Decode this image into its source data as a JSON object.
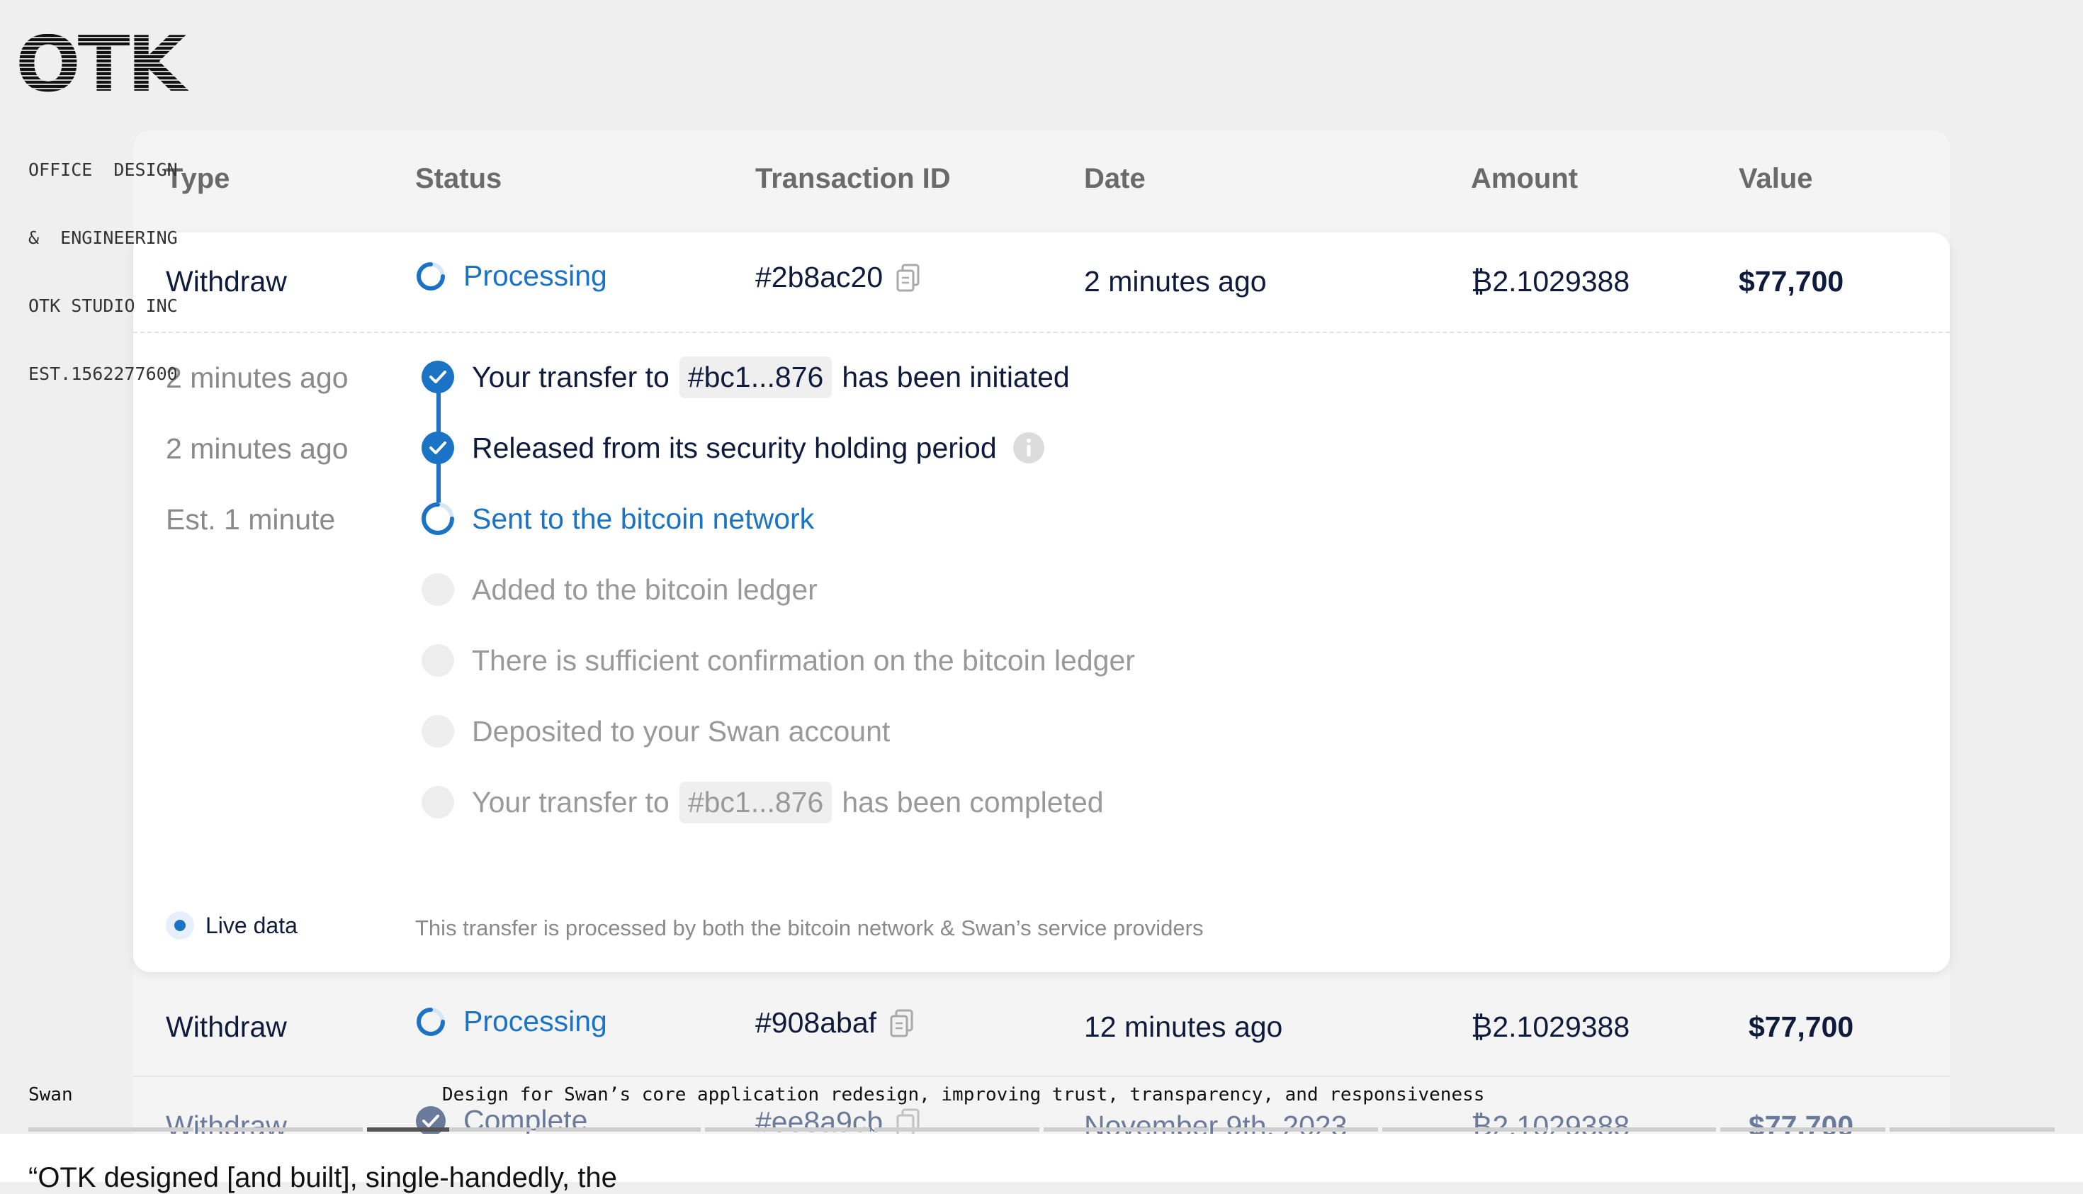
{
  "brand": {
    "logo_text": "OTK",
    "info_lines": [
      "OFFICE  DESIGN",
      "&  ENGINEERING",
      "OTK STUDIO INC",
      "EST.1562277600"
    ]
  },
  "table": {
    "headers": {
      "type": "Type",
      "status": "Status",
      "txid": "Transaction ID",
      "date": "Date",
      "amount": "Amount",
      "value": "Value"
    },
    "expanded_row": {
      "type": "Withdraw",
      "status": "Processing",
      "txid": "#2b8ac20",
      "date": "2 minutes ago",
      "amount": "₿2.1029388",
      "value": "$77,700"
    },
    "timeline": [
      {
        "time": "2 minutes ago",
        "state": "done",
        "pre": "Your transfer to",
        "chip": "#bc1...876",
        "post": "has been initiated"
      },
      {
        "time": "2 minutes ago",
        "state": "done",
        "pre": "Released from its security holding period",
        "info": true
      },
      {
        "time": "Est. 1 minute",
        "state": "active",
        "pre": "Sent to the bitcoin network"
      },
      {
        "time": "",
        "state": "pending",
        "pre": "Added to the bitcoin ledger"
      },
      {
        "time": "",
        "state": "pending",
        "pre": "There is sufficient confirmation on the bitcoin ledger"
      },
      {
        "time": "",
        "state": "pending",
        "pre": "Deposited to your Swan account"
      },
      {
        "time": "",
        "state": "pending",
        "pre": "Your transfer to",
        "chip": "#bc1...876",
        "post": "has been completed"
      }
    ],
    "footer": {
      "live_label": "Live data",
      "note": "This transfer is processed by both the bitcoin network & Swan’s service providers"
    },
    "rows": [
      {
        "type": "Withdraw",
        "status": "Processing",
        "status_kind": "processing",
        "txid": "#908abaf",
        "date": "12 minutes ago",
        "amount": "₿2.1029388",
        "value": "$77,700"
      },
      {
        "type": "Withdraw",
        "status": "Complete",
        "status_kind": "complete",
        "txid": "#ee8a9cb",
        "date": "November 9th, 2023",
        "amount": "₿2.1029388",
        "value": "$77,700"
      }
    ]
  },
  "caption": {
    "client": "Swan",
    "description": "Design for Swan’s core application redesign, improving trust, transparency, and responsiveness",
    "slides_total": 12,
    "slide_current": 3,
    "slide_current_progress": 0.5
  },
  "quote": "“OTK designed [and built], single-handedly, the"
}
